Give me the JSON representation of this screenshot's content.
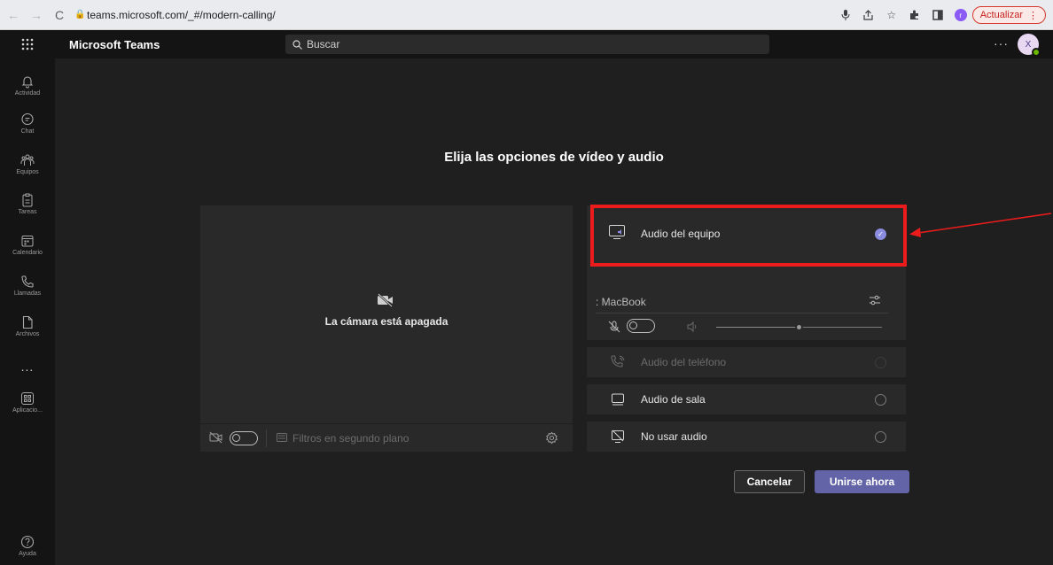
{
  "browser": {
    "url": "teams.microsoft.com/_#/modern-calling/",
    "update_label": "Actualizar",
    "profile_initial": "r"
  },
  "header": {
    "app_title": "Microsoft Teams",
    "search_placeholder": "Buscar",
    "avatar_initial": "X"
  },
  "rail": {
    "items": [
      {
        "label": "Actividad",
        "icon": "bell-icon"
      },
      {
        "label": "Chat",
        "icon": "chat-icon"
      },
      {
        "label": "Equipos",
        "icon": "teams-icon"
      },
      {
        "label": "Tareas",
        "icon": "tasks-icon"
      },
      {
        "label": "Calendario",
        "icon": "calendar-icon"
      },
      {
        "label": "Llamadas",
        "icon": "phone-icon"
      },
      {
        "label": "Archivos",
        "icon": "file-icon"
      },
      {
        "label": "...",
        "icon": "more-icon"
      },
      {
        "label": "Aplicacio...",
        "icon": "apps-icon"
      },
      {
        "label": "Ayuda",
        "icon": "help-icon"
      }
    ]
  },
  "main": {
    "title": "Elija las opciones de vídeo y audio",
    "video": {
      "camera_off_text": "La cámara está apagada",
      "filters_label": "Filtros en segundo plano"
    },
    "audio": {
      "computer_audio": "Audio del equipo",
      "device": ": MacBook",
      "phone_audio": "Audio del teléfono",
      "room_audio": "Audio de sala",
      "no_audio": "No usar audio",
      "volume_fraction": 0.5
    },
    "buttons": {
      "cancel": "Cancelar",
      "join": "Unirse ahora"
    }
  },
  "colors": {
    "accent": "#6264a7",
    "highlight": "#ec1c1c",
    "selected_radio": "#8b8ce0"
  }
}
